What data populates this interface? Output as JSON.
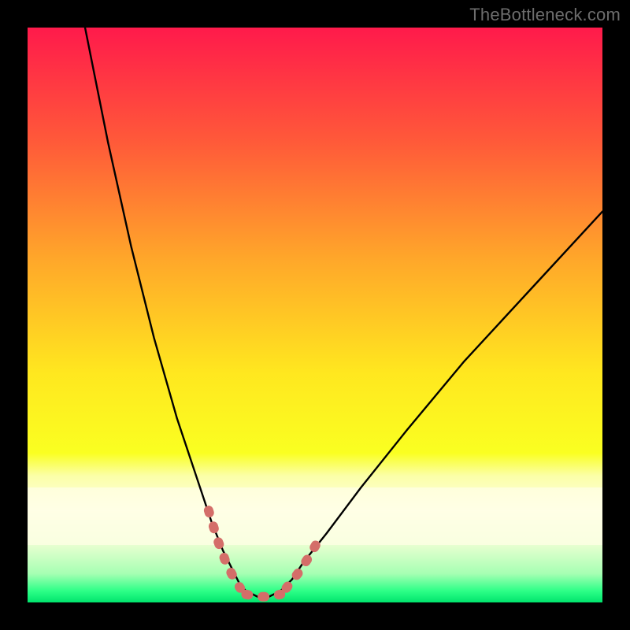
{
  "watermark": "TheBottleneck.com",
  "chart_data": {
    "type": "line",
    "title": "",
    "xlabel": "",
    "ylabel": "",
    "xlim": [
      0,
      100
    ],
    "ylim": [
      0,
      100
    ],
    "background_gradient_rows": [
      {
        "y": 0,
        "color": "#ff1a4b"
      },
      {
        "y": 20,
        "color": "#ff5a39"
      },
      {
        "y": 40,
        "color": "#ffa62a"
      },
      {
        "y": 60,
        "color": "#ffe71f"
      },
      {
        "y": 74,
        "color": "#faff21"
      },
      {
        "y": 78,
        "color": "#fbffa8"
      },
      {
        "y": 84,
        "color": "#ffffe5"
      },
      {
        "y": 90,
        "color": "#e7ffd0"
      },
      {
        "y": 95,
        "color": "#a6ffb3"
      },
      {
        "y": 98,
        "color": "#2dff87"
      },
      {
        "y": 100,
        "color": "#00e46d"
      }
    ],
    "series": [
      {
        "name": "bottleneck-curve",
        "stroke": "#000000",
        "x": [
          10,
          14,
          18,
          22,
          26,
          30,
          32,
          34,
          36,
          37,
          38,
          40,
          42,
          44,
          46,
          48,
          52,
          58,
          66,
          76,
          88,
          100
        ],
        "y": [
          0,
          20,
          38,
          54,
          68,
          80,
          86,
          91,
          95,
          97,
          98,
          99,
          99,
          98,
          96,
          93,
          88,
          80,
          70,
          58,
          45,
          32
        ]
      }
    ],
    "highlight_segments": {
      "name": "valley-markers",
      "stroke": "#d46e69",
      "segments": [
        {
          "x": [
            31.5,
            33.0,
            34.5,
            36.0,
            37.0
          ],
          "y": [
            84,
            89,
            93,
            96,
            97.5
          ]
        },
        {
          "x": [
            38.0,
            40.0,
            42.0,
            44.0
          ],
          "y": [
            98.6,
            99.0,
            99.0,
            98.6
          ]
        },
        {
          "x": [
            45.0,
            47.0,
            49.0,
            51.0
          ],
          "y": [
            97.5,
            95.0,
            92.0,
            88.5
          ]
        }
      ]
    }
  }
}
